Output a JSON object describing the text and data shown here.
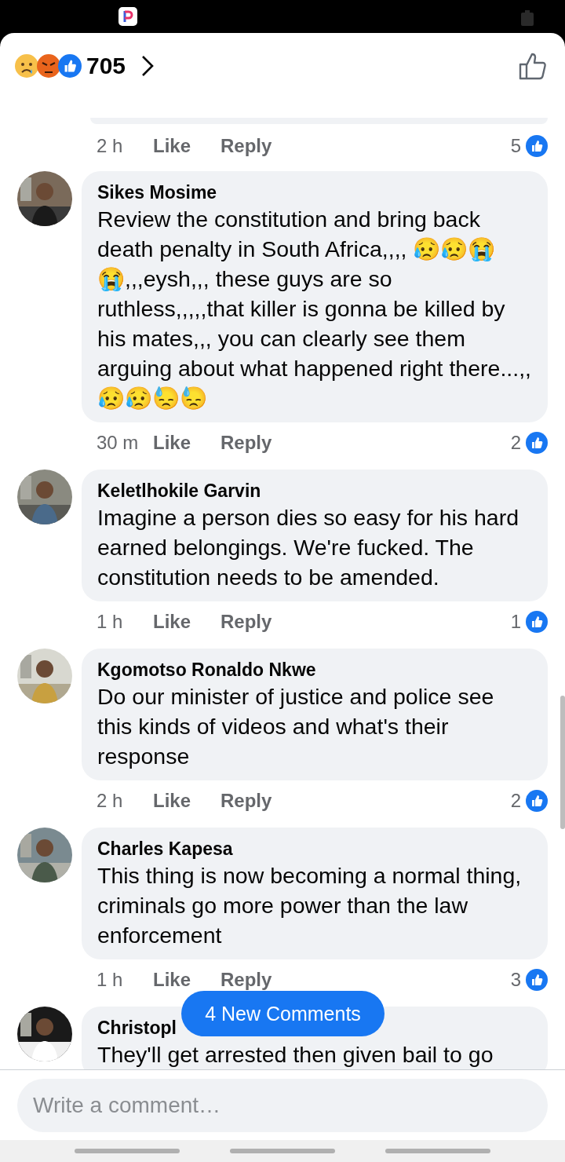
{
  "header": {
    "reaction_count": "705"
  },
  "previous_comment": {
    "time": "2 h",
    "like_label": "Like",
    "reply_label": "Reply",
    "likes": "5"
  },
  "comments": [
    {
      "author": "Sikes Mosime",
      "text": "Review the constitution and bring back death penalty in South Africa,,,, 😥😥😭😭,,,eysh,,, these guys are so ruthless,,,,,that killer is gonna be killed by his mates,,, you can clearly see them arguing about what happened right there...,,😥😥😓😓",
      "time": "30 m",
      "like_label": "Like",
      "reply_label": "Reply",
      "likes": "2"
    },
    {
      "author": "Keletlhokile Garvin",
      "text": "Imagine a person dies so easy for his hard earned belongings.  We're fucked. The constitution needs to be amended.",
      "time": "1 h",
      "like_label": "Like",
      "reply_label": "Reply",
      "likes": "1"
    },
    {
      "author": "Kgomotso Ronaldo Nkwe",
      "text": "Do our minister of justice and police see this kinds of videos and what's their response",
      "time": "2 h",
      "like_label": "Like",
      "reply_label": "Reply",
      "likes": "2"
    },
    {
      "author": "Charles Kapesa",
      "text": "This thing is now becoming a normal thing, criminals go more power than the law enforcement",
      "time": "1 h",
      "like_label": "Like",
      "reply_label": "Reply",
      "likes": "3"
    },
    {
      "author": "Christopl",
      "text": "They'll get arrested then given bail to go"
    }
  ],
  "new_comments_button": "4 New Comments",
  "composer": {
    "placeholder": "Write a comment…"
  }
}
